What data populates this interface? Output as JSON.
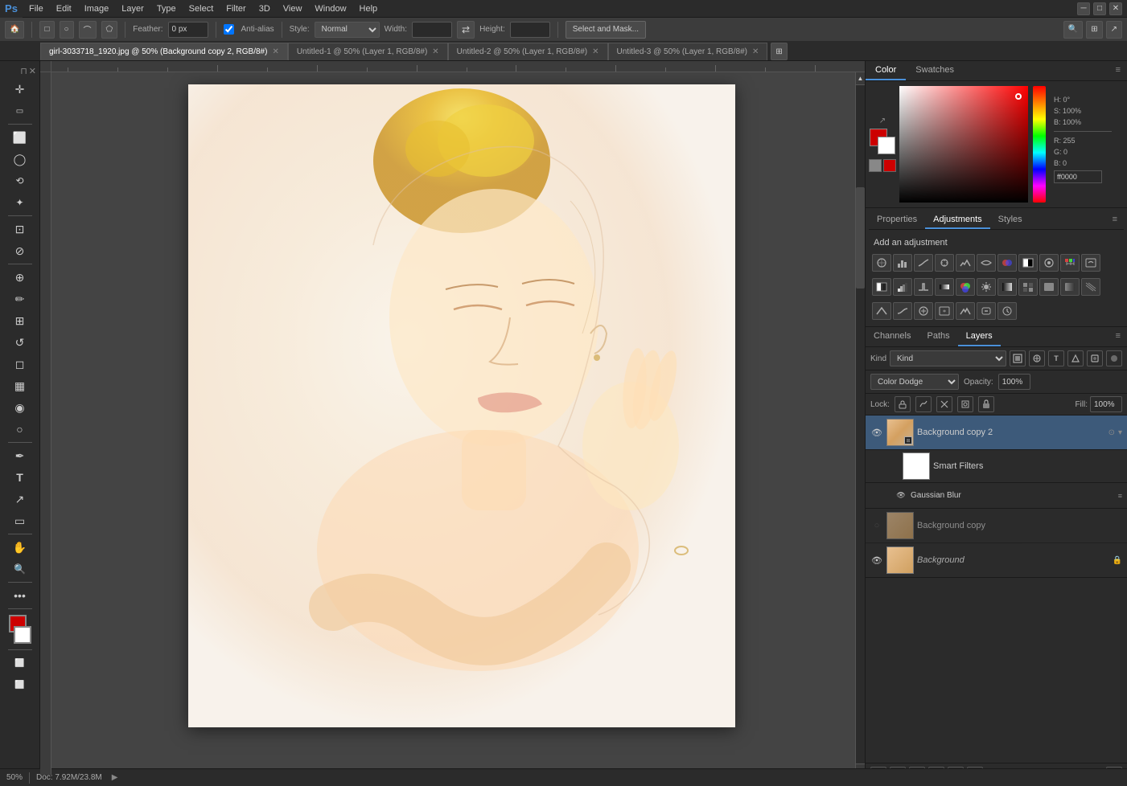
{
  "app": {
    "logo": "Ps",
    "version": "Photoshop"
  },
  "menubar": {
    "items": [
      "Ps",
      "File",
      "Edit",
      "Image",
      "Layer",
      "Type",
      "Select",
      "Filter",
      "3D",
      "View",
      "Window",
      "Help"
    ]
  },
  "options_bar": {
    "feather_label": "Feather:",
    "feather_value": "0 px",
    "anti_alias_label": "Anti-alias",
    "style_label": "Style:",
    "style_value": "Normal",
    "width_label": "Width:",
    "width_value": "",
    "height_label": "Height:",
    "height_value": "",
    "select_mask_btn": "Select and Mask..."
  },
  "tabs": [
    {
      "label": "girl-3033718_1920.jpg @ 50% (Background copy 2, RGB/8#)",
      "active": true,
      "closable": true
    },
    {
      "label": "Untitled-1 @ 50% (Layer 1, RGB/8#)",
      "active": false,
      "closable": true
    },
    {
      "label": "Untitled-2 @ 50% (Layer 1, RGB/8#)",
      "active": false,
      "closable": true
    },
    {
      "label": "Untitled-3 @ 50% (Layer 1, RGB/8#)",
      "active": false,
      "closable": true
    }
  ],
  "tools": [
    {
      "id": "move",
      "icon": "✛",
      "active": false
    },
    {
      "id": "marquee-rect",
      "icon": "⬜",
      "active": false
    },
    {
      "id": "lasso",
      "icon": "⟳",
      "active": false
    },
    {
      "id": "magic-wand",
      "icon": "✦",
      "active": false
    },
    {
      "id": "crop",
      "icon": "⊡",
      "active": false
    },
    {
      "id": "eyedropper",
      "icon": "⊘",
      "active": false
    },
    {
      "id": "heal",
      "icon": "⊕",
      "active": false
    },
    {
      "id": "brush",
      "icon": "✏",
      "active": false
    },
    {
      "id": "stamp",
      "icon": "⊞",
      "active": false
    },
    {
      "id": "eraser",
      "icon": "◫",
      "active": false
    },
    {
      "id": "gradient",
      "icon": "▦",
      "active": false
    },
    {
      "id": "dodge",
      "icon": "◉",
      "active": false
    },
    {
      "id": "pen",
      "icon": "✒",
      "active": false
    },
    {
      "id": "type",
      "icon": "T",
      "active": false
    },
    {
      "id": "path-select",
      "icon": "↗",
      "active": false
    },
    {
      "id": "rect-shape",
      "icon": "▭",
      "active": false
    },
    {
      "id": "hand",
      "icon": "✋",
      "active": false
    },
    {
      "id": "zoom",
      "icon": "🔍",
      "active": false
    }
  ],
  "color_panel": {
    "tabs": [
      "Color",
      "Swatches"
    ],
    "active_tab": "Color"
  },
  "swatches_panel": {
    "title": "Swatches"
  },
  "adjustments_panel": {
    "tabs": [
      "Properties",
      "Adjustments",
      "Styles"
    ],
    "active_tab": "Adjustments",
    "add_adjustment_label": "Add an adjustment"
  },
  "layers_panel": {
    "tabs": [
      "Channels",
      "Paths",
      "Layers"
    ],
    "active_tab": "Layers",
    "kind_label": "Kind",
    "blend_mode": "Color Dodge",
    "opacity_label": "Opacity:",
    "opacity_value": "100%",
    "lock_label": "Lock:",
    "fill_label": "Fill:",
    "fill_value": "100%",
    "layers": [
      {
        "id": "bg-copy-2",
        "name": "Background copy 2",
        "visible": true,
        "active": true,
        "locked": false,
        "has_smart_filters": true,
        "sub_layers": [
          {
            "id": "smart-filters",
            "name": "Smart Filters",
            "visible": true
          },
          {
            "id": "gaussian-blur",
            "name": "Gaussian Blur",
            "visible": true
          }
        ]
      },
      {
        "id": "bg-copy",
        "name": "Background copy",
        "visible": false,
        "active": false,
        "locked": false
      },
      {
        "id": "background",
        "name": "Background",
        "visible": true,
        "active": false,
        "locked": true
      }
    ]
  },
  "status_bar": {
    "zoom": "50%",
    "doc_sizes": "Doc: 7.92M/23.8M"
  }
}
